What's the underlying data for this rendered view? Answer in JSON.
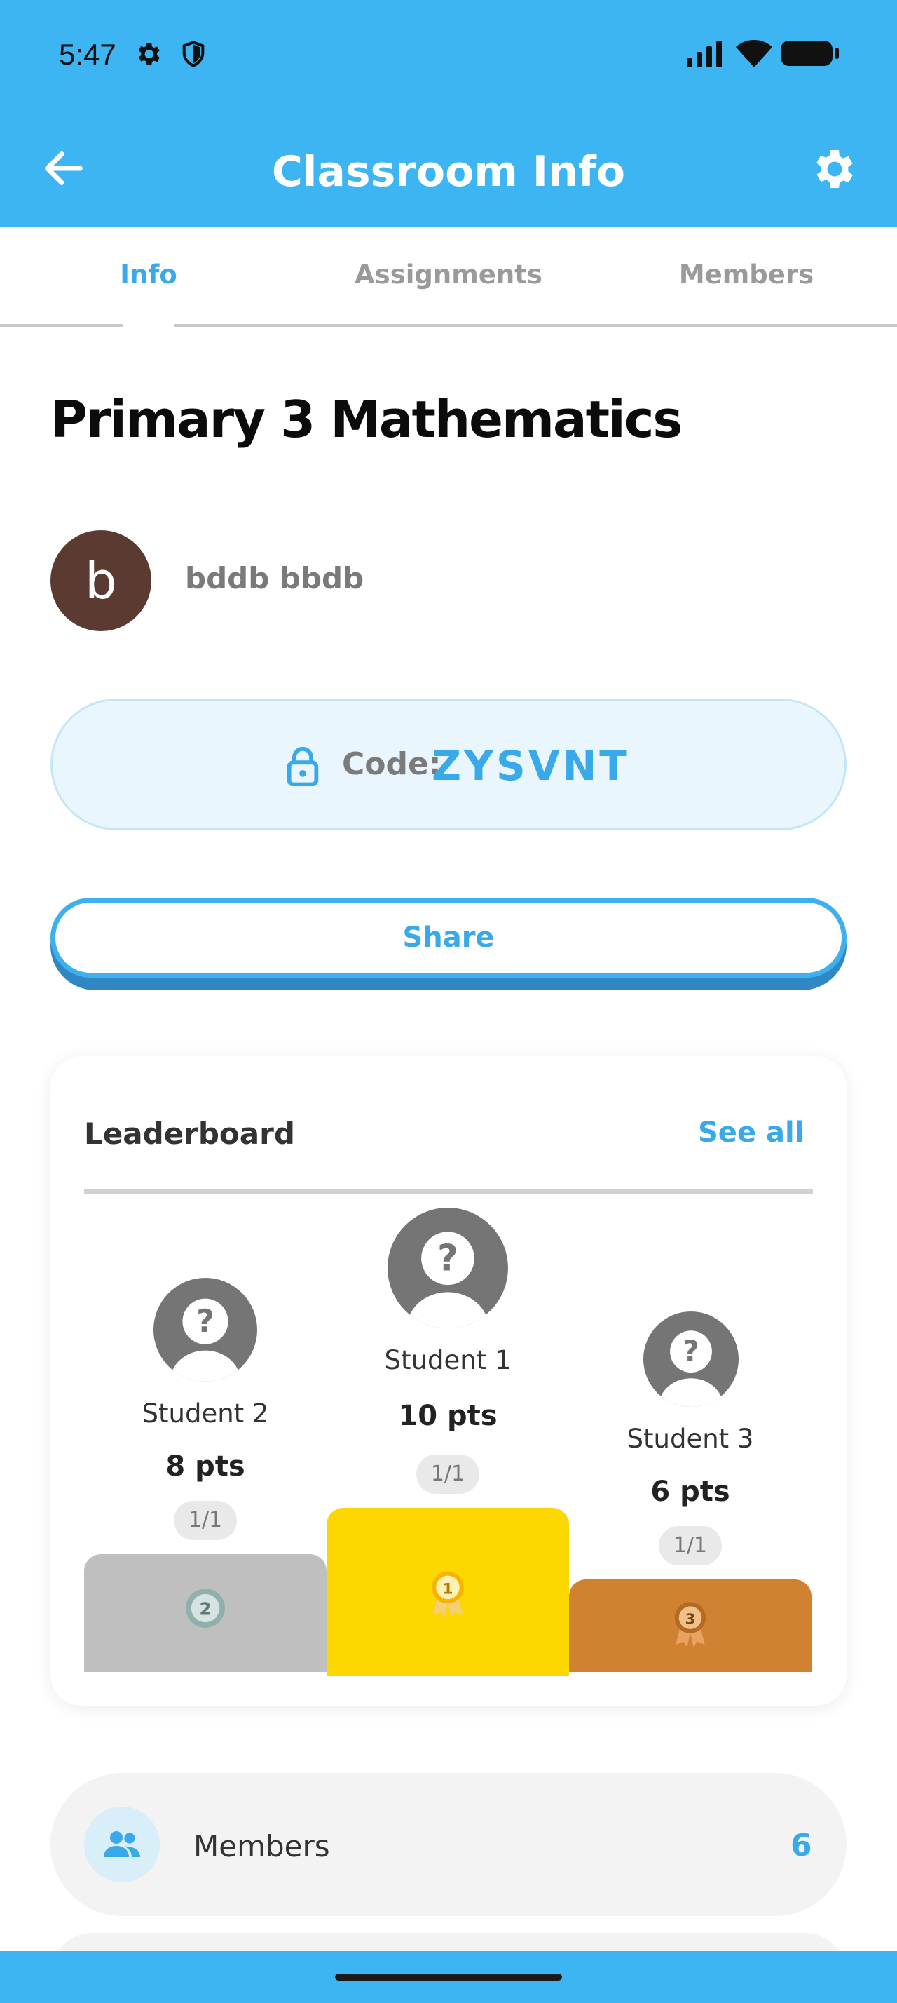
{
  "status_bar": {
    "time": "5:47",
    "left_icons": [
      "gear-icon",
      "shield-icon"
    ],
    "right_icons": [
      "signal-icon",
      "wifi-icon",
      "battery-icon"
    ]
  },
  "app_bar": {
    "title": "Classroom Info",
    "back_icon": "arrow-left-icon",
    "settings_icon": "gear-icon"
  },
  "tabs": [
    {
      "label": "Info",
      "active": true
    },
    {
      "label": "Assignments",
      "active": false
    },
    {
      "label": "Members",
      "active": false
    }
  ],
  "classroom": {
    "title": "Primary 3 Mathematics",
    "owner": {
      "initial": "b",
      "name": "bddb bbdb"
    },
    "code_label": "Code:",
    "code": "ZYSVNT"
  },
  "share_label": "Share",
  "leaderboard": {
    "title": "Leaderboard",
    "see_all": "See all",
    "podium": [
      {
        "rank": "2",
        "name": "Student 2",
        "points": "8 pts",
        "progress": "1/1"
      },
      {
        "rank": "1",
        "name": "Student 1",
        "points": "10 pts",
        "progress": "1/1"
      },
      {
        "rank": "3",
        "name": "Student 3",
        "points": "6 pts",
        "progress": "1/1"
      }
    ]
  },
  "members_row": {
    "label": "Members",
    "count": "6",
    "icon": "people-icon"
  },
  "colors": {
    "brand": "#3db5f3",
    "accent_text": "#3aa9ea",
    "gold": "#fdd700",
    "silver": "#bfbfbf",
    "bronze": "#d08232"
  }
}
